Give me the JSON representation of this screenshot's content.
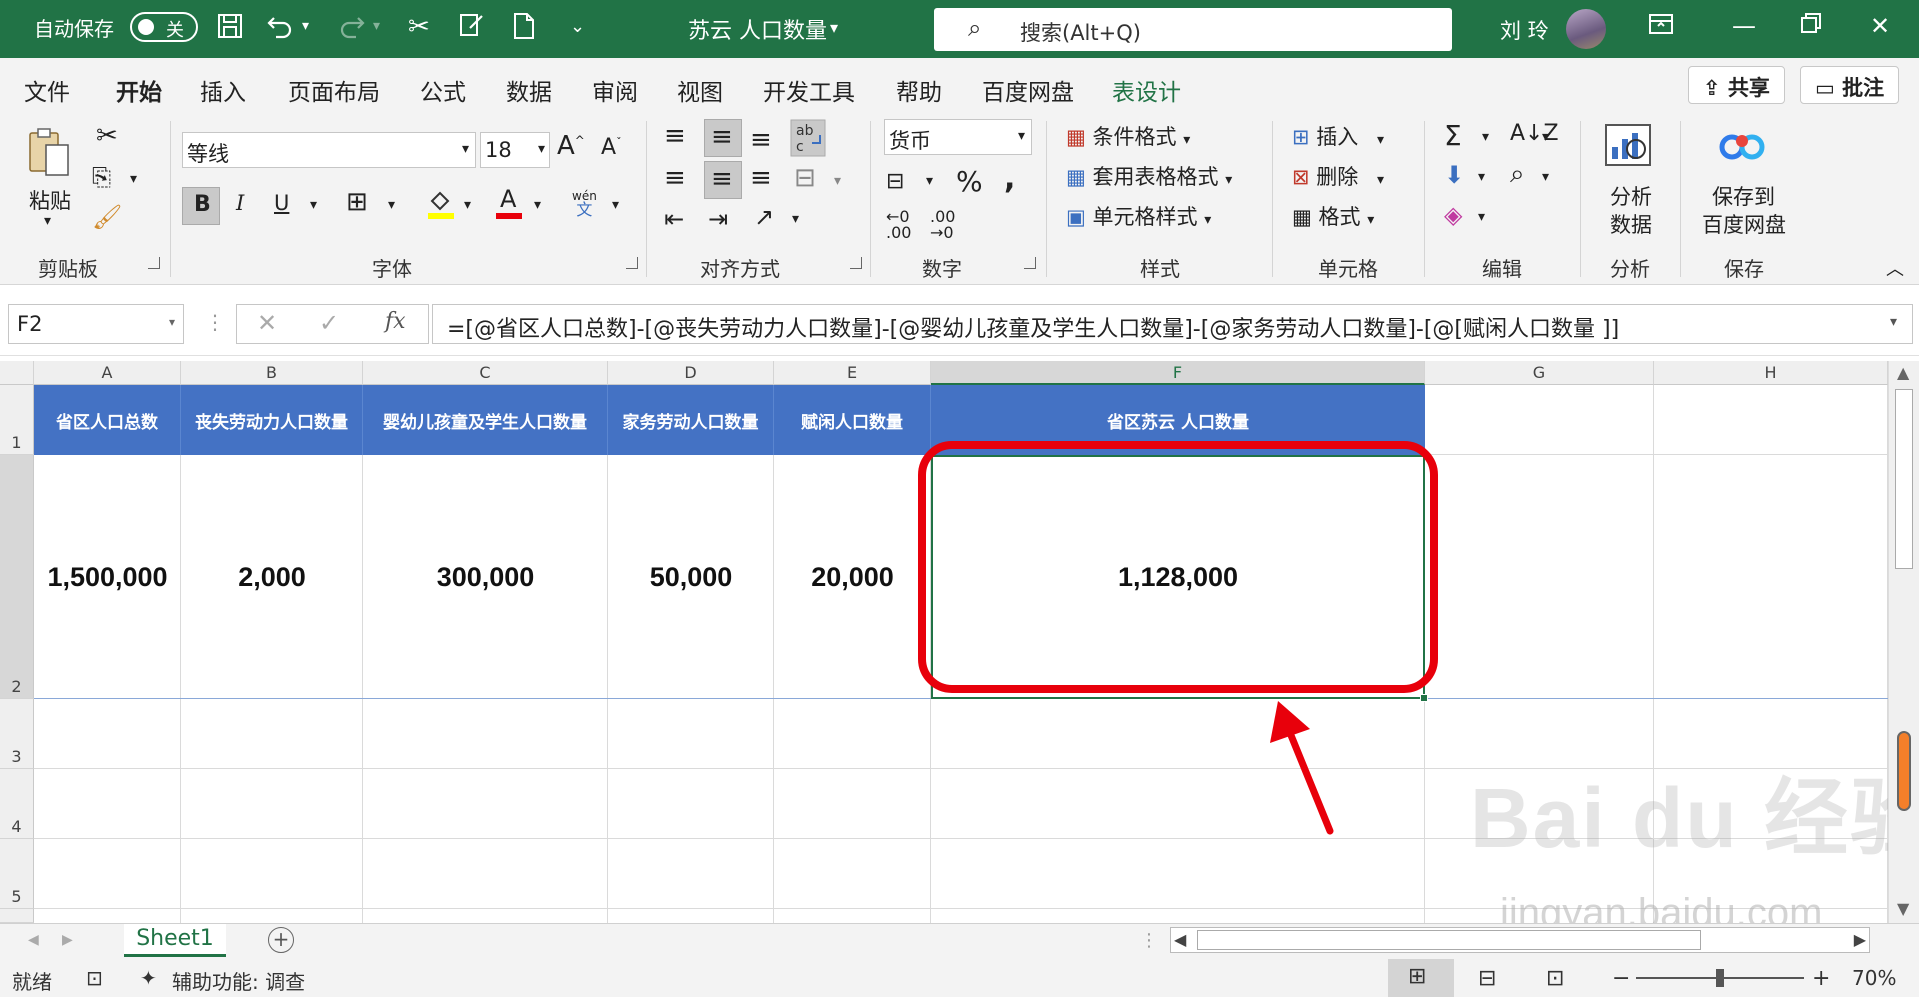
{
  "titlebar": {
    "autosave_label": "自动保存",
    "autosave_state": "关",
    "doc_title": "苏云 人口数量",
    "search_placeholder": "搜索(Alt+Q)",
    "user_name": "刘 玲"
  },
  "menu": {
    "tabs": [
      "文件",
      "开始",
      "插入",
      "页面布局",
      "公式",
      "数据",
      "审阅",
      "视图",
      "开发工具",
      "帮助",
      "百度网盘",
      "表设计"
    ],
    "active_tab": "开始",
    "share_label": "共享",
    "comment_label": "批注"
  },
  "ribbon": {
    "groups": [
      "剪贴板",
      "字体",
      "对齐方式",
      "数字",
      "样式",
      "单元格",
      "编辑",
      "分析",
      "保存"
    ],
    "paste_label": "粘贴",
    "font_name": "等线",
    "font_size": "18",
    "phonetic_label": "wén",
    "phonetic_sub": "文",
    "number_format": "货币",
    "conditional_format": "条件格式",
    "format_as_table": "套用表格格式",
    "cell_styles": "单元格样式",
    "insert": "插入",
    "delete": "删除",
    "format": "格式",
    "analyze_data_line1": "分析",
    "analyze_data_line2": "数据",
    "save_baidu_line1": "保存到",
    "save_baidu_line2": "百度网盘"
  },
  "formula_bar": {
    "name_box": "F2",
    "formula": "=[@省区人口总数]-[@丧失劳动力人口数量]-[@婴幼儿孩童及学生人口数量]-[@家务劳动人口数量]-[@[赋闲人口数量 ]]"
  },
  "grid": {
    "columns": [
      "A",
      "B",
      "C",
      "D",
      "E",
      "F",
      "G",
      "H"
    ],
    "row_numbers": [
      "1",
      "2",
      "3",
      "4",
      "5"
    ],
    "header_row": [
      "省区人口总数",
      "丧失劳动力人口数量",
      "婴幼儿孩童及学生人口数量",
      "家务劳动人口数量",
      "赋闲人口数量",
      "省区苏云 人口数量"
    ],
    "data_row": [
      "1,500,000",
      "2,000",
      "300,000",
      "50,000",
      "20,000",
      "1,128,000"
    ],
    "selected_column": "F",
    "accent_color": "#4472c4",
    "highlight_color": "#e8000b"
  },
  "sheets": {
    "tabs": [
      "Sheet1"
    ],
    "add_label": "+"
  },
  "status": {
    "ready": "就绪",
    "accessibility": "辅助功能: 调查",
    "zoom": "70%",
    "zoom_fraction": 0.5
  },
  "watermark": {
    "brand": "Bai du 经验",
    "url": "jingyan.baidu.com"
  }
}
